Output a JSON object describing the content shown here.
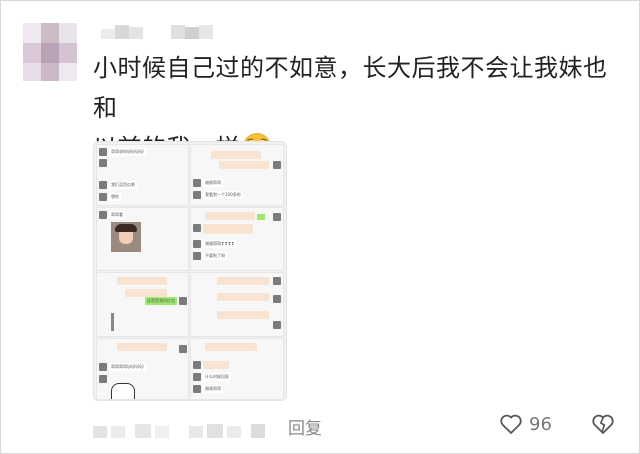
{
  "comment": {
    "text_line1": "小时候自己过的不如意，长大后我不会让我妹也和",
    "text_line2": "以前的我一样",
    "emoji": "pleading-face-emoji"
  },
  "screenshot_grid": {
    "panel1": {
      "msg1": "哥哥求你🐱🐱🐱🐱",
      "msg2": "我们买西瓜吧",
      "msg3": "想吃"
    },
    "panel2": {
      "msg1": "谢谢哥哥",
      "msg2": "我看到一个100多的"
    },
    "panel3": {
      "msg1": "哥哥看"
    },
    "panel4": {
      "msg1": "谢谢哥哥❣❣❣❣",
      "msg2": "不要啦了呀"
    },
    "panel5": {
      "msg1": "这是是我的红包"
    },
    "panel7": {
      "msg1": "哥哥哥哥🐱🐱🐱🐱"
    },
    "panel8": {
      "msg1": "什么时候回家",
      "msg2": "谢谢哥哥"
    }
  },
  "actions": {
    "reply_label": "回复",
    "like_count": "96",
    "like_icon": "heart-outline-icon",
    "dislike_icon": "broken-heart-icon"
  }
}
